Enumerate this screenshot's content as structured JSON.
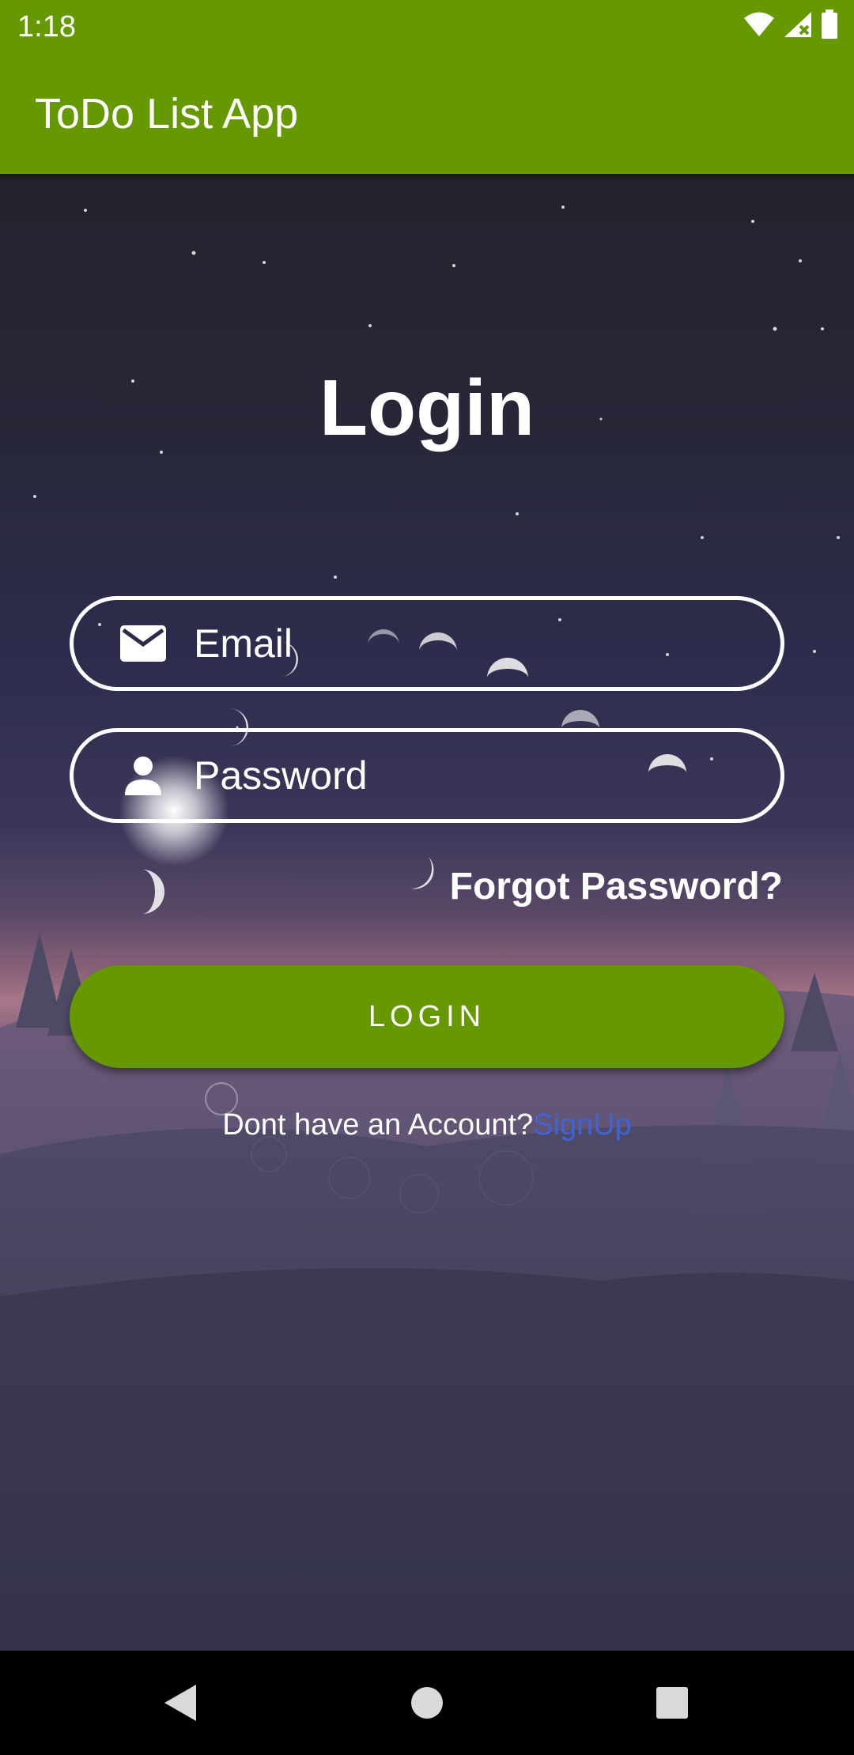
{
  "status_bar": {
    "time": "1:18",
    "icons": [
      "wifi-icon",
      "signal-icon",
      "battery-icon"
    ]
  },
  "app_bar": {
    "title": "ToDo List App"
  },
  "login": {
    "heading": "Login",
    "email_placeholder": "Email",
    "email_icon": "email-icon",
    "password_placeholder": "Password",
    "password_icon": "person-icon",
    "forgot_password": "Forgot Password?",
    "login_button": "LOGIN",
    "signup_prompt": "Dont have an Account?",
    "signup_link": "SignUp"
  },
  "nav_bar": {
    "icons": [
      "back-icon",
      "home-icon",
      "recents-icon"
    ]
  },
  "colors": {
    "accent": "#669900",
    "link": "#3f64d4",
    "text": "#ffffff"
  }
}
